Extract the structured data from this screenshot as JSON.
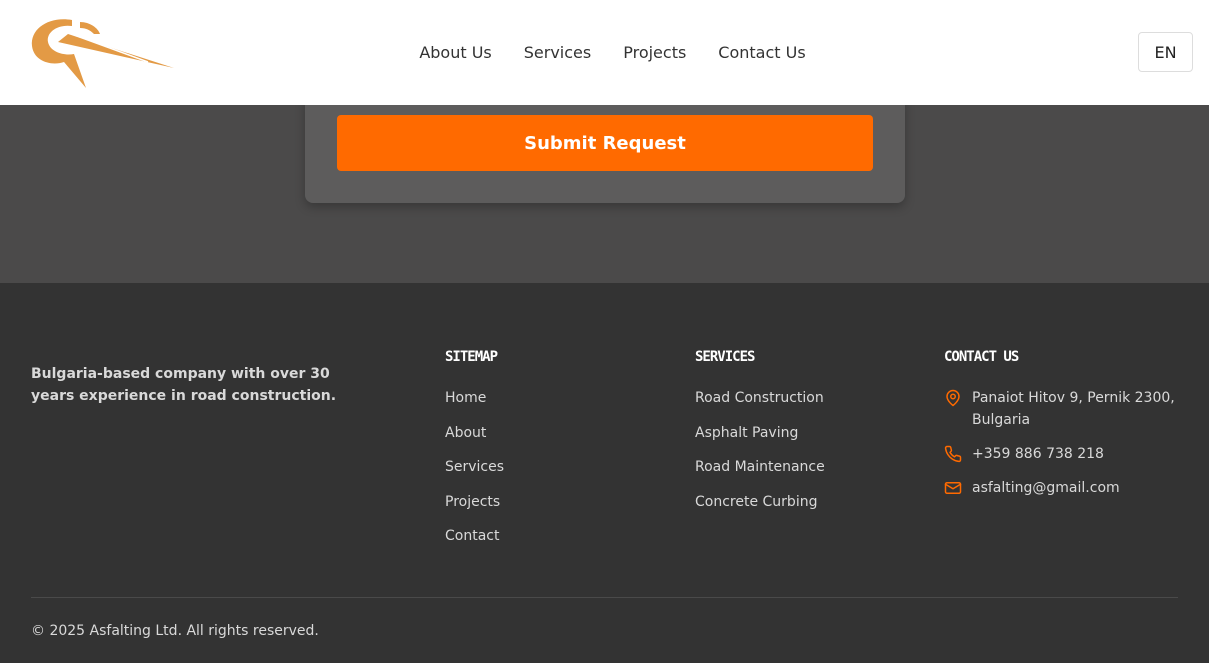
{
  "colors": {
    "accent": "#ff6a00",
    "logo": "#e39a45",
    "footer_bg": "#333333",
    "section_bg": "#4b4a4a"
  },
  "header": {
    "nav": [
      "About Us",
      "Services",
      "Projects",
      "Contact Us"
    ],
    "language": "EN"
  },
  "form": {
    "submit_label": "Submit Request"
  },
  "footer": {
    "about": "Bulgaria-based company with over 30 years experience in road construction.",
    "sitemap": {
      "title": "SITEMAP",
      "links": [
        "Home",
        "About",
        "Services",
        "Projects",
        "Contact"
      ]
    },
    "services": {
      "title": "SERVICES",
      "links": [
        "Road Construction",
        "Asphalt Paving",
        "Road Maintenance",
        "Concrete Curbing"
      ]
    },
    "contact": {
      "title": "CONTACT US",
      "address": "Panaiot Hitov 9, Pernik 2300, Bulgaria",
      "phone": "+359 886 738 218",
      "email": "asfalting@gmail.com"
    },
    "copyright": "© 2025 Asfalting Ltd. All rights reserved."
  }
}
